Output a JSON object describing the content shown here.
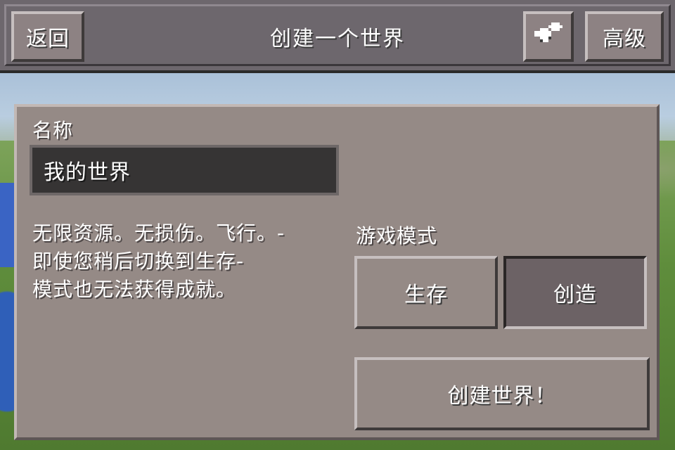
{
  "header": {
    "back_label": "返回",
    "title": "创建一个世界",
    "icon_name": "puzzle-icon",
    "advanced_label": "高级"
  },
  "form": {
    "name_label": "名称",
    "name_value": "我的世界",
    "description_lines": [
      "无限资源。无损伤。飞行。-",
      "即使您稍后切换到生存-",
      "模式也无法获得成就。"
    ],
    "game_mode_label": "游戏模式",
    "modes": [
      {
        "label": "生存",
        "selected": false
      },
      {
        "label": "创造",
        "selected": true
      }
    ],
    "create_label": "创建世界！"
  }
}
